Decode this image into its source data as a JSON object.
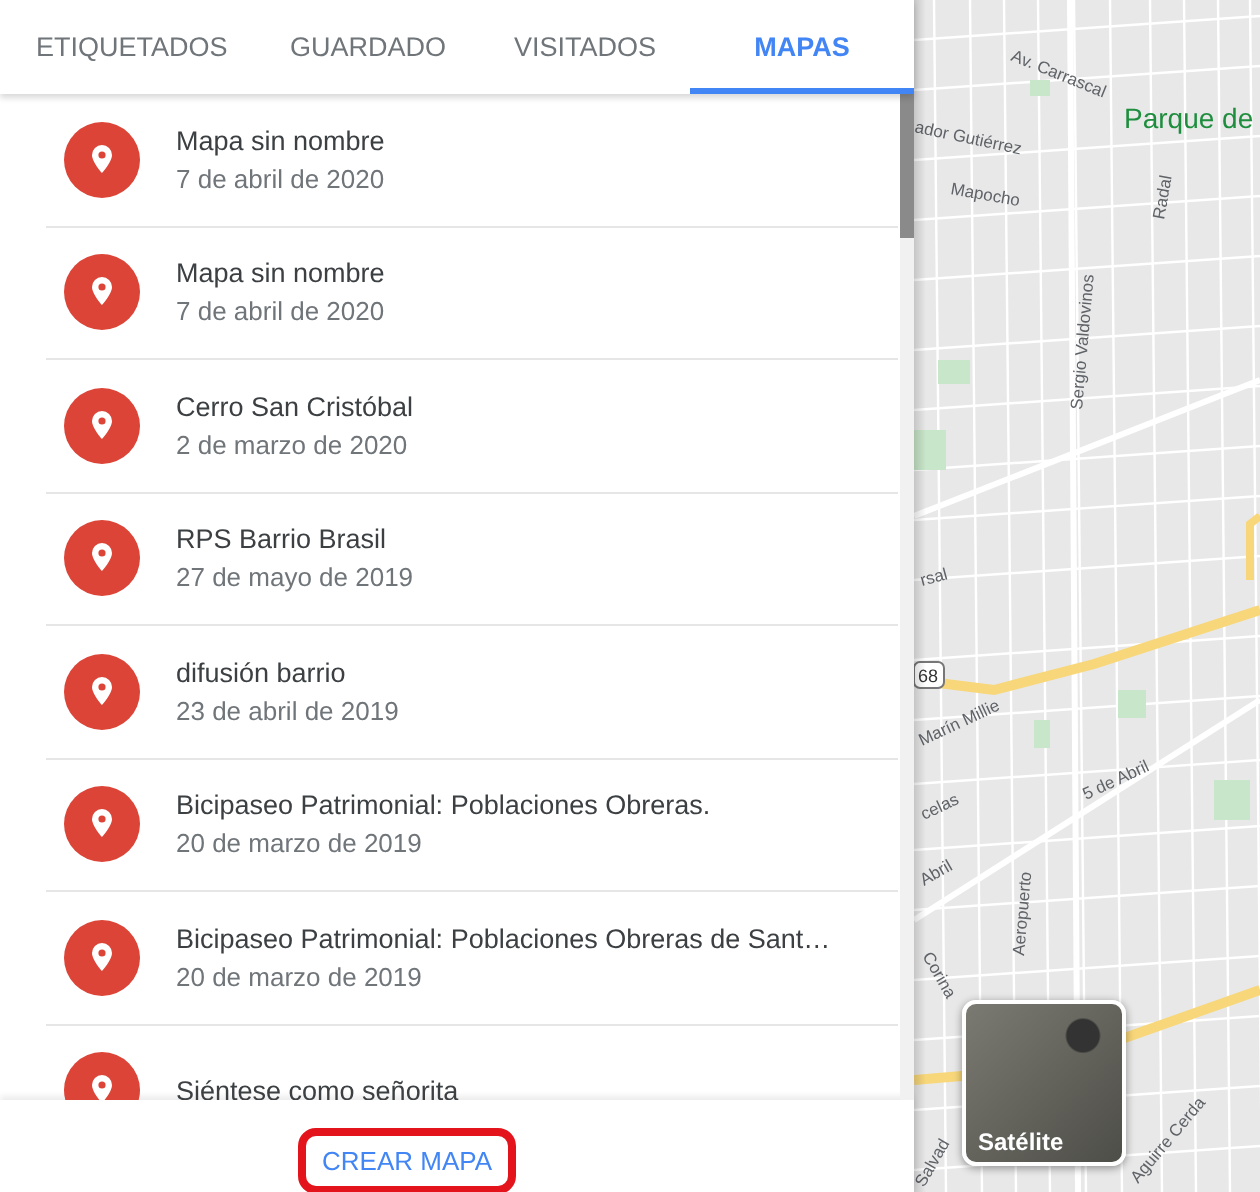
{
  "tabs": [
    {
      "label": "ETIQUETADOS",
      "selected": false
    },
    {
      "label": "GUARDADO",
      "selected": false
    },
    {
      "label": "VISITADOS",
      "selected": false
    },
    {
      "label": "MAPAS",
      "selected": true
    }
  ],
  "maps": [
    {
      "title": "Mapa sin nombre",
      "date": "7 de abril de 2020"
    },
    {
      "title": "Mapa sin nombre",
      "date": "7 de abril de 2020"
    },
    {
      "title": "Cerro San Cristóbal",
      "date": "2 de marzo de 2020"
    },
    {
      "title": "RPS Barrio Brasil",
      "date": "27 de mayo de 2019"
    },
    {
      "title": "difusión barrio",
      "date": "23 de abril de 2019"
    },
    {
      "title": "Bicipaseo Patrimonial: Poblaciones Obreras.",
      "date": "20 de marzo de 2019"
    },
    {
      "title": "Bicipaseo Patrimonial: Poblaciones Obreras de Sant…",
      "date": "20 de marzo de 2019"
    },
    {
      "title": "Siéntese como señorita"
    }
  ],
  "create_button": "CREAR MAPA",
  "map": {
    "park_label": "Parque de",
    "street_labels": [
      "Av. Carrascal",
      "ador Gutiérrez",
      "Mapocho",
      "Radal",
      "Sergio Valdovinos",
      "rsal",
      "Marín Millie",
      "celas",
      "5 de Abril",
      "Abril",
      "Aeropuerto",
      "Corina",
      "Salvad",
      "Aguirre Cerda"
    ],
    "route_shield": "68",
    "layer_button": "Satélite"
  }
}
